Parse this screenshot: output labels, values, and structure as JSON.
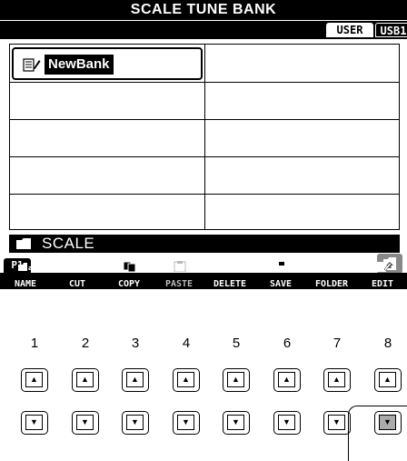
{
  "screen": {
    "title": "SCALE TUNE BANK",
    "tabs": [
      {
        "label": "USER",
        "active": true
      },
      {
        "label": "USB1",
        "active": false
      }
    ],
    "files": [
      {
        "name": "NewBank",
        "icon": "bank-file-icon",
        "selected": true
      }
    ],
    "path": "SCALE",
    "page": "P1",
    "function_buttons": [
      {
        "label": "NAME",
        "icon": "name-icon",
        "enabled": true
      },
      {
        "label": "CUT",
        "icon": "scissors-icon",
        "enabled": true
      },
      {
        "label": "COPY",
        "icon": "copy-icon",
        "enabled": true
      },
      {
        "label": "PASTE",
        "icon": "paste-icon",
        "enabled": false
      },
      {
        "label": "DELETE",
        "icon": "trash-icon",
        "enabled": true
      },
      {
        "label": "SAVE",
        "icon": "floppy-icon",
        "enabled": true
      },
      {
        "label": "FOLDER",
        "icon": "new-folder-icon",
        "enabled": true
      },
      {
        "label": "EDIT",
        "icon": "edit-icon",
        "enabled": true
      }
    ],
    "up_button_icon": "folder-up-icon"
  },
  "panel_buttons": {
    "numbers": [
      "1",
      "2",
      "3",
      "4",
      "5",
      "6",
      "7",
      "8"
    ],
    "up_arrow": "▲",
    "down_arrow": "▼",
    "highlighted": "8-down"
  }
}
